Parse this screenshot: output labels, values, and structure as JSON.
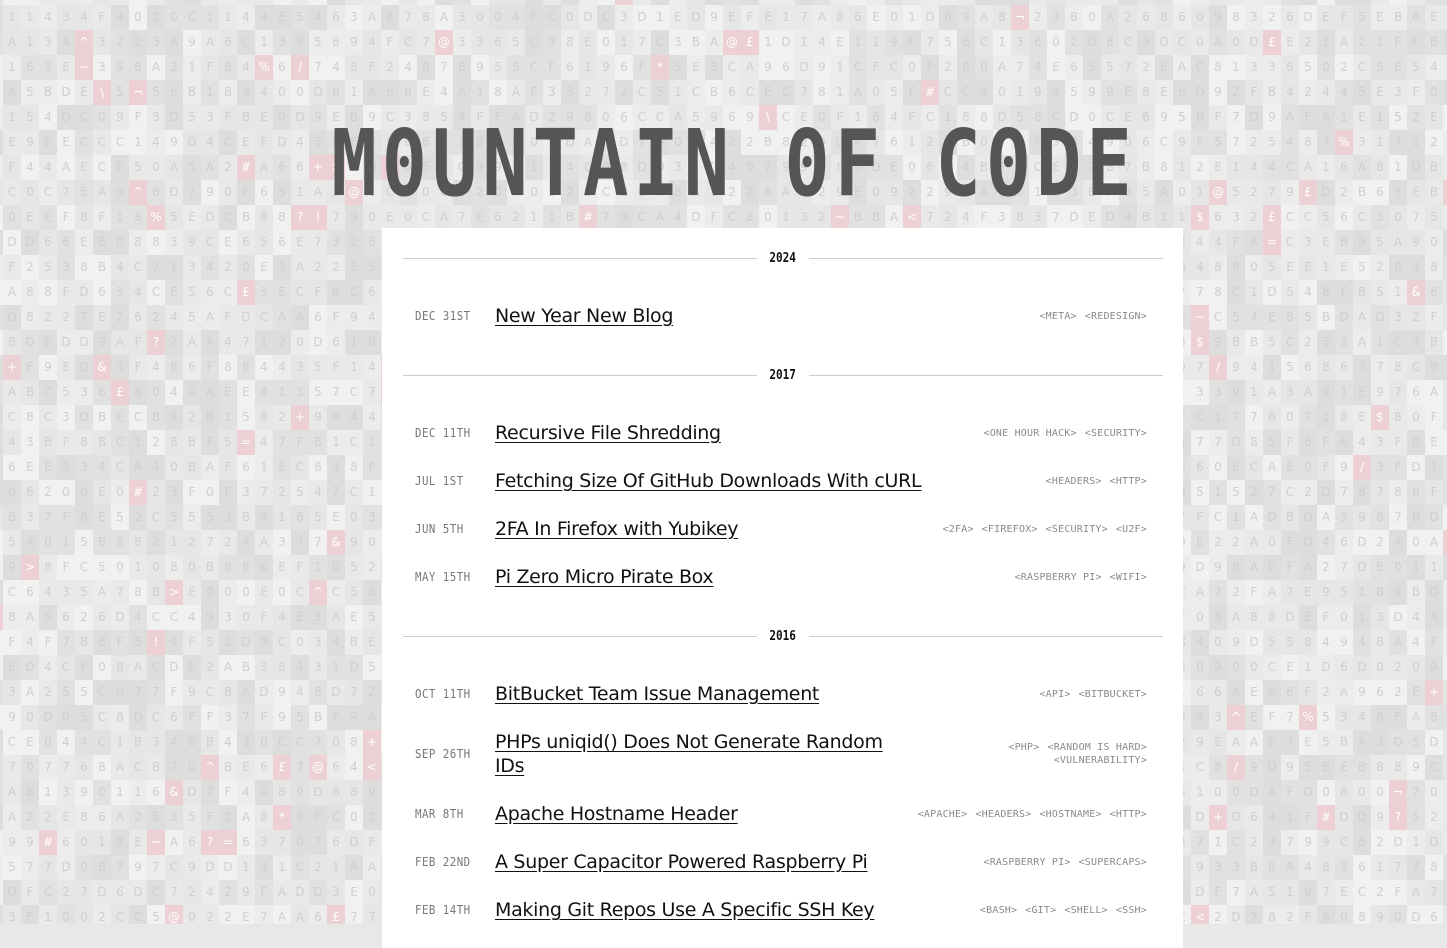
{
  "site": {
    "title": "M0UNTAIN 0F C0DE"
  },
  "background": {
    "charset": "0123456789ABCDEF",
    "special_chars": [
      "!",
      "@",
      "%",
      "~",
      "/",
      "&",
      "?",
      "+",
      "$",
      "£",
      "^",
      "\\",
      "¬",
      "<",
      ">",
      "*",
      "#",
      "="
    ],
    "cell_colors": [
      "#e0e1e0",
      "#e6e6e6",
      "#e9e9e9",
      "#ececec",
      "#f1f1f1",
      "#dcdddc"
    ],
    "special_color": "#ecd0d3"
  },
  "years": [
    {
      "year": "2024",
      "posts": [
        {
          "date": "DEC 31ST",
          "title": "New Year New Blog",
          "tags": [
            "<META>",
            "<REDESIGN>"
          ]
        }
      ]
    },
    {
      "year": "2017",
      "posts": [
        {
          "date": "DEC 11TH",
          "title": "Recursive File Shredding",
          "tags": [
            "<ONE HOUR HACK>",
            "<SECURITY>"
          ]
        },
        {
          "date": "JUL 1ST",
          "title": "Fetching Size Of GitHub Downloads With cURL",
          "tags": [
            "<HEADERS>",
            "<HTTP>"
          ]
        },
        {
          "date": "JUN 5TH",
          "title": "2FA In Firefox with Yubikey",
          "tags": [
            "<2FA>",
            "<FIREFOX>",
            "<SECURITY>",
            "<U2F>"
          ]
        },
        {
          "date": "MAY 15TH",
          "title": "Pi Zero Micro Pirate Box",
          "tags": [
            "<RASPBERRY PI>",
            "<WIFI>"
          ]
        }
      ]
    },
    {
      "year": "2016",
      "posts": [
        {
          "date": "OCT 11TH",
          "title": "BitBucket Team Issue Management",
          "tags": [
            "<API>",
            "<BITBUCKET>"
          ]
        },
        {
          "date": "SEP 26TH",
          "title": "PHPs uniqid() Does Not Generate Random IDs",
          "tags": [
            "<PHP>",
            "<RANDOM IS HARD>",
            "<VULNERABILITY>"
          ]
        },
        {
          "date": "MAR 8TH",
          "title": "Apache Hostname Header",
          "tags": [
            "<APACHE>",
            "<HEADERS>",
            "<HOSTNAME>",
            "<HTTP>"
          ]
        },
        {
          "date": "FEB 22ND",
          "title": "A Super Capacitor Powered Raspberry Pi",
          "tags": [
            "<RASPBERRY PI>",
            "<SUPERCAPS>"
          ]
        },
        {
          "date": "FEB 14TH",
          "title": "Making Git Repos Use A Specific SSH Key",
          "tags": [
            "<BASH>",
            "<GIT>",
            "<SHELL>",
            "<SSH>"
          ]
        }
      ]
    }
  ]
}
